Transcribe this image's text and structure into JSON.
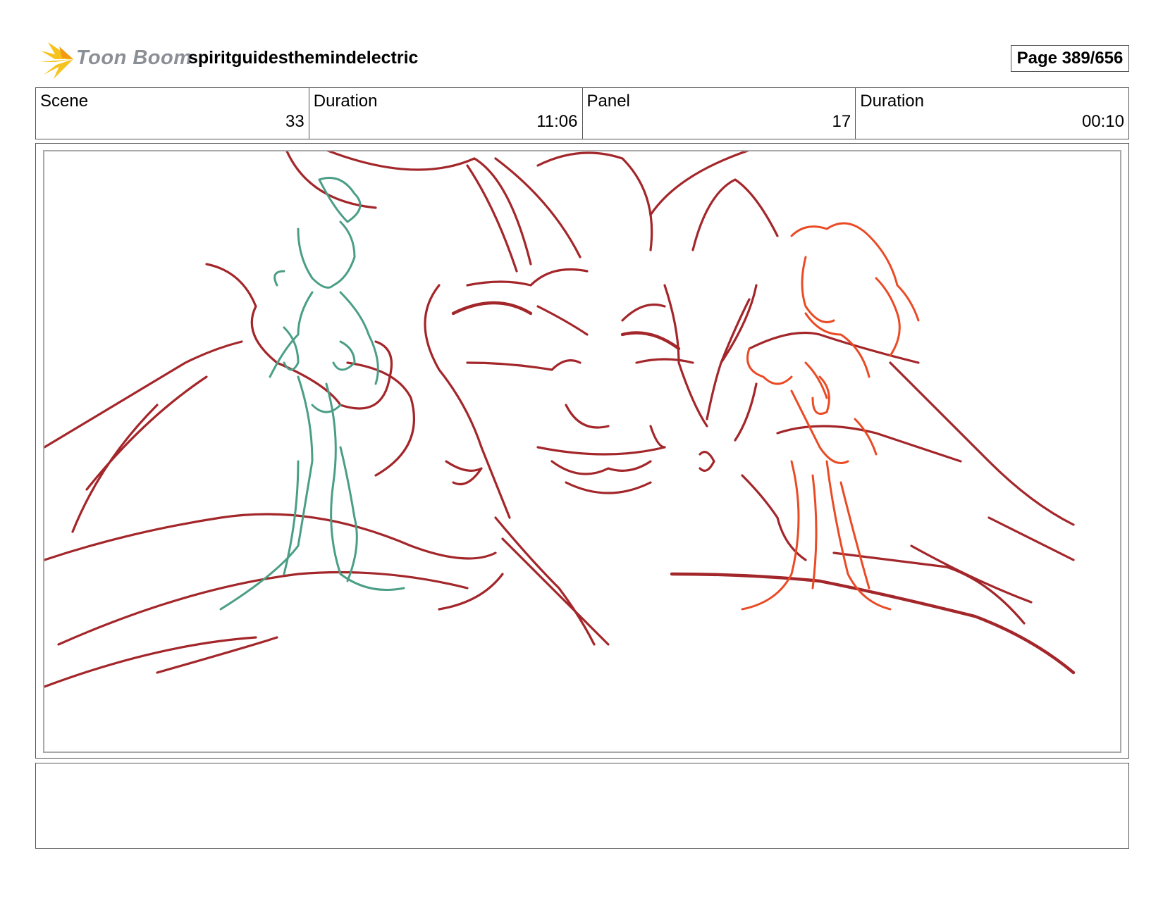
{
  "header": {
    "logo_text": "Toon Boom",
    "logo_icon": "starburst-icon",
    "project_title": "spiritguidesthemindelectric",
    "page_label": "Page 389/656"
  },
  "info": {
    "scene_label": "Scene",
    "scene_value": "33",
    "scene_duration_label": "Duration",
    "scene_duration_value": "11:06",
    "panel_label": "Panel",
    "panel_value": "17",
    "panel_duration_label": "Duration",
    "panel_duration_value": "00:10"
  },
  "panel": {
    "sketch_colors": {
      "demon": "#a3262a",
      "left_character": "#4a9e86",
      "right_character": "#ea4a24"
    }
  },
  "notes": {
    "text": ""
  }
}
